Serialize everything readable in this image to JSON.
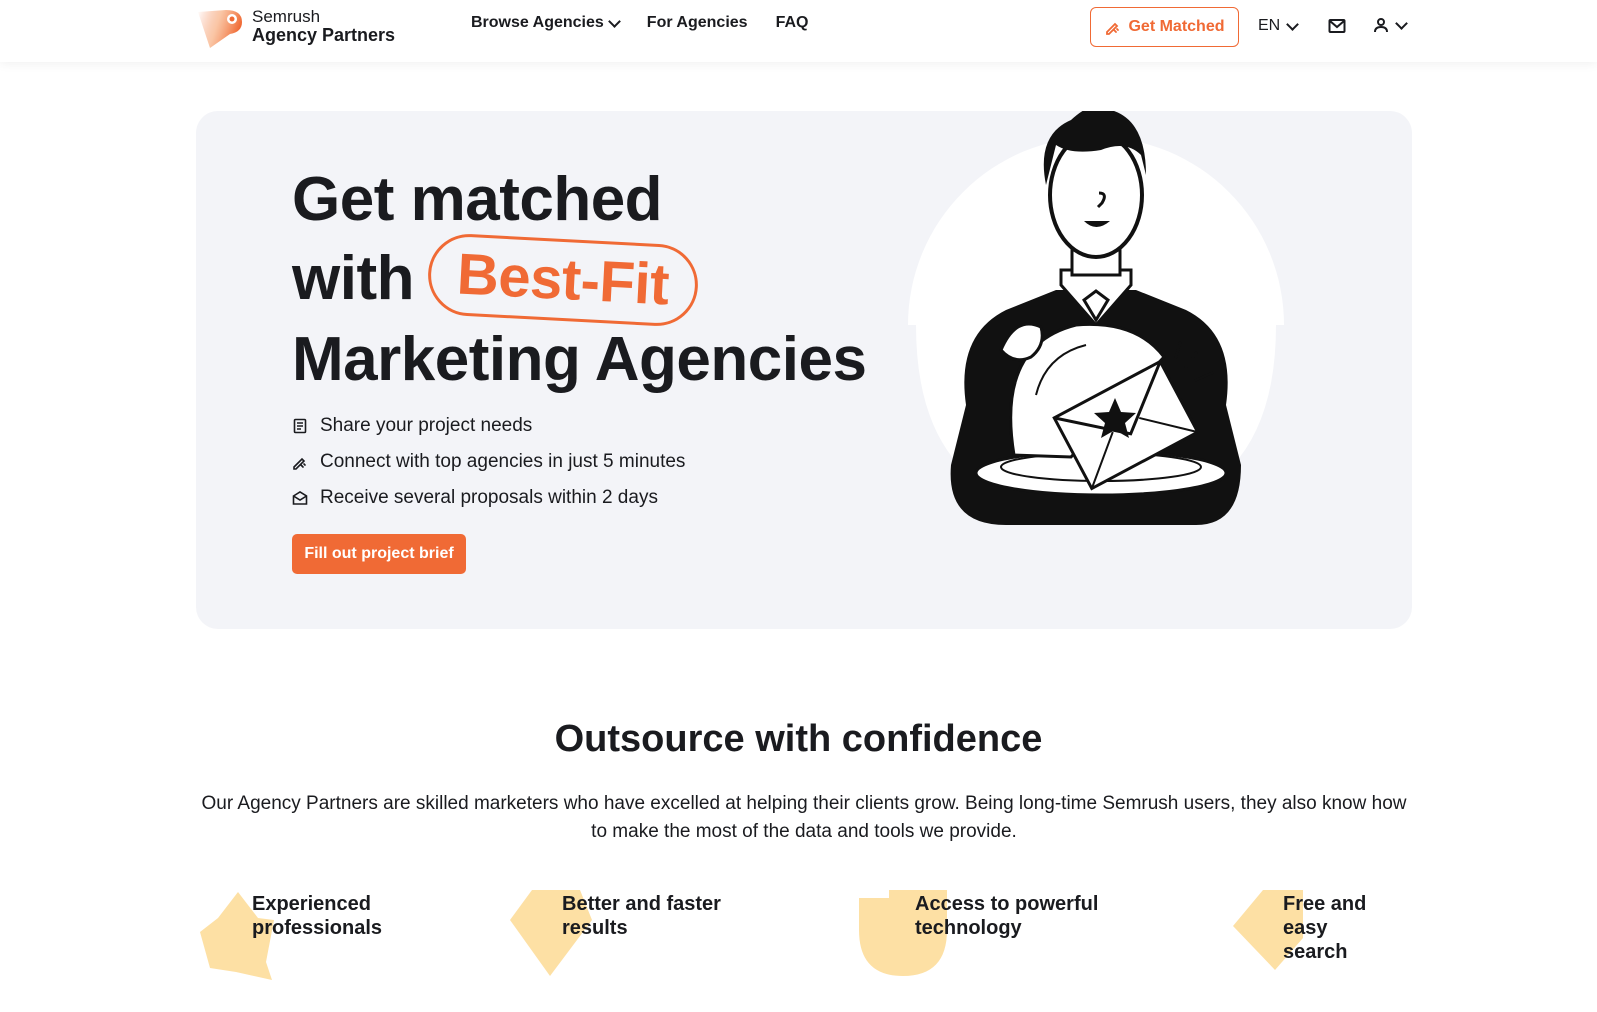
{
  "header": {
    "logo": {
      "line1": "Semrush",
      "line2": "Agency Partners"
    },
    "nav": [
      {
        "label": "Browse Agencies",
        "has_dropdown": true
      },
      {
        "label": "For Agencies",
        "has_dropdown": false
      },
      {
        "label": "FAQ",
        "has_dropdown": false
      }
    ],
    "get_matched_label": "Get Matched",
    "language": "EN"
  },
  "hero": {
    "title_line1": "Get matched",
    "title_line2_prefix": "with",
    "title_highlight": "Best-Fit",
    "title_line3": "Marketing Agencies",
    "features": [
      {
        "icon": "document-icon",
        "text": "Share your project needs"
      },
      {
        "icon": "pencil-sparkle-icon",
        "text": "Connect with top agencies in just 5 minutes"
      },
      {
        "icon": "envelope-open-icon",
        "text": "Receive several proposals within 2 days"
      }
    ],
    "cta_label": "Fill out project brief"
  },
  "section": {
    "title": "Outsource with confidence",
    "description": "Our Agency Partners are skilled marketers who have excelled at helping their clients grow. Being long-time Semrush users, they also know how to make the most of the data and tools we provide."
  },
  "benefits": [
    {
      "label": "Experienced\nprofessionals",
      "shape": "star"
    },
    {
      "label": "Better and faster\nresults",
      "shape": "diamond"
    },
    {
      "label": "Access to powerful\ntechnology",
      "shape": "quarter-circle"
    },
    {
      "label": "Free and easy\nsearch",
      "shape": "chevron"
    }
  ],
  "colors": {
    "accent": "#f06a35",
    "hero_bg": "#f3f4f8",
    "benefit_shape": "#fde0a4",
    "text": "#1a1b1f"
  }
}
